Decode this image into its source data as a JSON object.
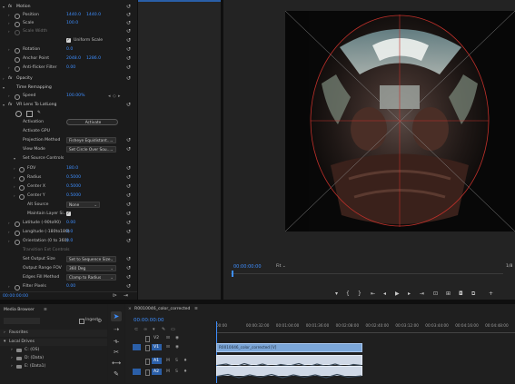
{
  "effect_controls": {
    "motion": {
      "header": "Motion",
      "position_label": "Position",
      "position_x": "1440.0",
      "position_y": "1440.0",
      "scale_label": "Scale",
      "scale_value": "100.0",
      "scale_width_label": "Scale Width",
      "uniform_scale_label": "Uniform Scale",
      "rotation_label": "Rotation",
      "rotation_value": "0.0",
      "anchor_label": "Anchor Point",
      "anchor_x": "2048.0",
      "anchor_y": "1286.0",
      "antiflicker_label": "Anti-flicker Filter",
      "antiflicker_value": "0.00"
    },
    "opacity_header": "Opacity",
    "time_remap": {
      "header": "Time Remapping",
      "speed_label": "Speed",
      "speed_value": "100.00%"
    },
    "vr": {
      "header": "VR Lens To LatLong",
      "activation_label": "Activation",
      "activation_button": "Activate",
      "activate_gpu_label": "Activate GPU",
      "projection_label": "Projection Method",
      "projection_value": "Fisheye Equidistant...",
      "view_mode_label": "View Mode",
      "view_mode_value": "Set Circle Over Sou...",
      "source_header": "Set Source Controls",
      "fov_label": "FOV",
      "fov_value": "180.0",
      "radius_label": "Radius",
      "radius_value": "0.5000",
      "centerx_label": "Center X",
      "centerx_value": "0.5000",
      "centery_label": "Center Y",
      "centery_value": "0.5000",
      "altsource_label": "Alt Source",
      "altsource_value": "None",
      "maintain_label": "Maintain Layer Si...",
      "latitude_label": "Latitude (-90to90)",
      "latitude_value": "0.00",
      "longitude_label": "Longitude (-180to180)",
      "longitude_value": "0.0",
      "orientation_label": "Orientation (0 to 360)",
      "orientation_value": "0.0",
      "subheader": "Transition Ext Controls",
      "output_size_label": "Set Output Size",
      "output_size_value": "Set to Sequence Size",
      "output_fov_label": "Output Range FOV",
      "output_fov_value": "360 Deg",
      "edges_label": "Edges Fill Method",
      "edges_value": "Clamp to Radius",
      "filter_pixels_label": "Filter Pixels",
      "filter_pixels_value": "0.00"
    },
    "timecode": "00:00:00:00"
  },
  "program": {
    "timecode": "00:00:00:00",
    "fit_label": "Fit",
    "page": "1/8",
    "accent": "#3d8eff"
  },
  "project": {
    "title": "Media Browser",
    "ingest_label": "Ingest",
    "favorites": "Favorites",
    "local_drives": "Local Drives",
    "drives": [
      "C: (OS)",
      "D: (Data)",
      "E: (Data1)"
    ]
  },
  "timeline": {
    "tab_title": "R0010046_color_corrected",
    "timecode": "00:00:00:00",
    "ruler": [
      "00:00",
      "00:00:32:00",
      "00:01:04:00",
      "00:01:36:00",
      "00:02:08:00",
      "00:02:40:00",
      "00:03:12:00",
      "00:03:44:00",
      "00:04:16:00",
      "00:04:48:00"
    ],
    "tracks_video": [
      "V2",
      "V1"
    ],
    "tracks_audio": [
      "A1",
      "A2"
    ],
    "clip_name": "R0010046_color_corrected [V]"
  }
}
